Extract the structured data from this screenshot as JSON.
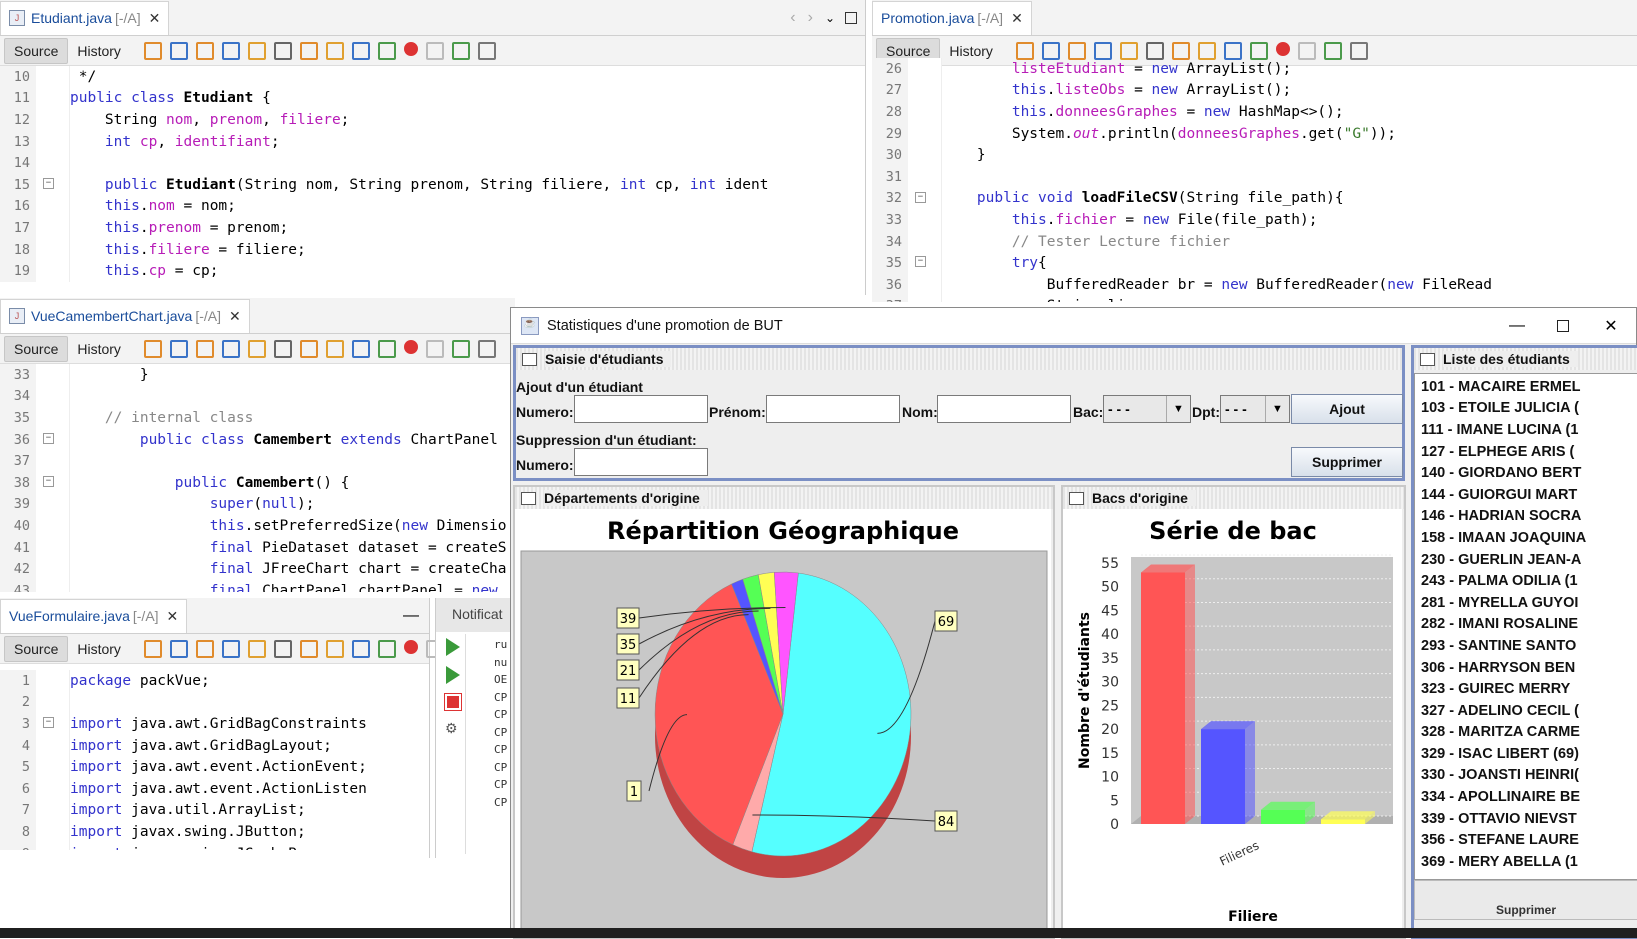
{
  "editor1": {
    "tab": {
      "file": "Etudiant.java",
      "mod": "[-/A]"
    },
    "source_label": "Source",
    "history_label": "History",
    "lines": [
      {
        "n": "10",
        "html": " */"
      },
      {
        "n": "11",
        "html": "<span class='kw'>public class</span> <b>Etudiant</b> {"
      },
      {
        "n": "12",
        "html": "    String <span class='fld'>nom</span>, <span class='fld'>prenom</span>, <span class='fld'>filiere</span>;"
      },
      {
        "n": "13",
        "html": "    <span class='kw'>int</span> <span class='fld'>cp</span>, <span class='fld'>identifiant</span>;"
      },
      {
        "n": "14",
        "html": ""
      },
      {
        "n": "15",
        "html": "    <span class='kw'>public</span> <b>Etudiant</b>(String nom, String prenom, String filiere, <span class='kw'>int</span> cp, <span class='kw'>int</span> ident"
      },
      {
        "n": "16",
        "html": "    <span class='kw'>this</span>.<span class='fld'>nom</span> = nom;"
      },
      {
        "n": "17",
        "html": "    <span class='kw'>this</span>.<span class='fld'>prenom</span> = prenom;"
      },
      {
        "n": "18",
        "html": "    <span class='kw'>this</span>.<span class='fld'>filiere</span> = filiere;"
      },
      {
        "n": "19",
        "html": "    <span class='kw'>this</span>.<span class='fld'>cp</span> = cp;"
      }
    ]
  },
  "editor2": {
    "tab": {
      "file": "Promotion.java",
      "mod": "[-/A]"
    },
    "source_label": "Source",
    "history_label": "History",
    "lines": [
      {
        "n": "26",
        "html": "        <span class='fld'>listeEtudiant</span> = <span class='kw'>new</span> ArrayList();"
      },
      {
        "n": "27",
        "html": "        <span class='kw'>this</span>.<span class='fld'>listeObs</span> = <span class='kw'>new</span> ArrayList();"
      },
      {
        "n": "28",
        "html": "        <span class='kw'>this</span>.<span class='fld'>donneesGraphes</span> = <span class='kw'>new</span> HashMap&lt;&gt;();"
      },
      {
        "n": "29",
        "html": "        System.<span class='fld'><i>out</i></span>.println(<span class='fld'>donneesGraphes</span>.get(<span class='str'>\"G\"</span>));"
      },
      {
        "n": "30",
        "html": "    }"
      },
      {
        "n": "31",
        "html": ""
      },
      {
        "n": "32",
        "html": "    <span class='kw'>public void</span> <b>loadFileCSV</b>(String file_path){"
      },
      {
        "n": "33",
        "html": "        <span class='kw'>this</span>.<span class='fld'>fichier</span> = <span class='kw'>new</span> File(file_path);"
      },
      {
        "n": "34",
        "html": "        <span class='cm'>// Tester Lecture fichier</span>"
      },
      {
        "n": "35",
        "html": "        <span class='kw'>try</span>{"
      },
      {
        "n": "36",
        "html": "            BufferedReader br = <span class='kw'>new</span> BufferedReader(<span class='kw'>new</span> FileRead"
      },
      {
        "n": "37",
        "html": "            String ligne;"
      }
    ]
  },
  "editor3": {
    "tab": {
      "file": "VueCamembertChart.java",
      "mod": "[-/A]"
    },
    "source_label": "Source",
    "history_label": "History",
    "lines": [
      {
        "n": "33",
        "html": "        }"
      },
      {
        "n": "34",
        "html": ""
      },
      {
        "n": "35",
        "html": "    <span class='cm'>// internal class</span>"
      },
      {
        "n": "36",
        "html": "        <span class='kw'>public class</span> <b>Camembert</b> <span class='kw'>extends</span> ChartPanel"
      },
      {
        "n": "37",
        "html": ""
      },
      {
        "n": "38",
        "html": "            <span class='kw'>public</span> <b>Camembert</b>() {"
      },
      {
        "n": "39",
        "html": "                <span class='kw'>super</span>(<span class='kw'>null</span>);"
      },
      {
        "n": "40",
        "html": "                <span class='kw'>this</span>.setPreferredSize(<span class='kw'>new</span> Dimensio"
      },
      {
        "n": "41",
        "html": "                <span class='kw'>final</span> PieDataset dataset = createS"
      },
      {
        "n": "42",
        "html": "                <span class='kw'>final</span> JFreeChart chart = createCha"
      },
      {
        "n": "43",
        "html": "                <span class='kw'>final</span> ChartPanel chartPanel = <span class='kw'>new</span>"
      }
    ]
  },
  "editor4": {
    "tab": {
      "file": "VueFormulaire.java",
      "mod": "[-/A]"
    },
    "source_label": "Source",
    "history_label": "History",
    "lines": [
      {
        "n": "1",
        "html": "<span class='kw'>package</span> packVue;"
      },
      {
        "n": "2",
        "html": ""
      },
      {
        "n": "3",
        "html": "<span class='kw'>import</span> java.awt.GridBagConstraints"
      },
      {
        "n": "4",
        "html": "<span class='kw'>import</span> java.awt.GridBagLayout;"
      },
      {
        "n": "5",
        "html": "<span class='kw'>import</span> java.awt.event.ActionEvent;"
      },
      {
        "n": "6",
        "html": "<span class='kw'>import</span> java.awt.event.ActionListen"
      },
      {
        "n": "7",
        "html": "<span class='kw'>import</span> java.util.ArrayList;"
      },
      {
        "n": "8",
        "html": "<span class='kw'>import</span> javax.swing.JButton;"
      },
      {
        "n": "9",
        "html": "<span class='kw'>import</span> javax.swing.JComboBox;"
      }
    ]
  },
  "notifications": {
    "title": "Notificat",
    "lines": [
      "ru",
      "nu",
      "OE",
      "CP",
      "CP",
      "CP",
      "CP",
      "CP",
      "CP",
      "CP"
    ]
  },
  "app": {
    "title": "Statistiques d'une promotion de BUT",
    "saisie": {
      "title": "Saisie d'étudiants",
      "ajout_label": "Ajout d'un étudiant",
      "numero_label": "Numero:",
      "prenom_label": "Prénom:",
      "nom_label": "Nom:",
      "bac_label": "Bac:",
      "bac_value": "- - -",
      "dpt_label": "Dpt:",
      "dpt_value": "- - -",
      "ajout_button": "Ajout",
      "suppression_label": "Suppression d'un étudiant:",
      "numero2_label": "Numero:",
      "supprimer_button": "Supprimer"
    },
    "liste": {
      "title": "Liste des étudiants",
      "items": [
        "101 - MACAIRE ERMEL",
        "103 - ETOILE JULICIA (",
        "111 - IMANE LUCINA (1",
        "127 - ELPHEGE ARIS (",
        "140 - GIORDANO BERT",
        "144 - GUIORGUI MART",
        "146 - HADRIAN SOCRA",
        "158 - IMAAN JOAQUINA",
        "230 - GUERLIN JEAN-A",
        "243 - PALMA ODILIA (1",
        "281 - MYRELLA GUYOI",
        "282 - IMANI ROSALINE",
        "293 - SANTINE SANTO",
        "306 - HARRYSON BEN",
        "323 - GUIREC MERRY",
        "327 - ADELINO CECIL (",
        "328 - MARITZA CARME",
        "329 - ISAC LIBERT (69)",
        "330 - JOANSTI HEINRI(",
        "334 - APOLLINAIRE BE",
        "339 - OTTAVIO NIEVST",
        "356 - STEFANE LAURE",
        "369 - MERY ABELLA (1"
      ],
      "footer": "Supprimer"
    },
    "departements": {
      "title": "Départements d'origine"
    },
    "bacs": {
      "title": "Bacs d'origine"
    }
  },
  "chart_data": [
    {
      "type": "pie",
      "title": "Répartition Géographique",
      "slices": [
        {
          "label": "69",
          "value": 52,
          "color": "#55ffff"
        },
        {
          "label": "84",
          "value": 2.5,
          "color": "#ffaaaa"
        },
        {
          "label": "1",
          "value": 37,
          "color": "#ff5555"
        },
        {
          "label": "11",
          "value": 1.5,
          "color": "#5555ff"
        },
        {
          "label": "21",
          "value": 2,
          "color": "#55ff55"
        },
        {
          "label": "35",
          "value": 2,
          "color": "#ffff55"
        },
        {
          "label": "39",
          "value": 3,
          "color": "#ff55ff"
        }
      ]
    },
    {
      "type": "bar",
      "title": "Série de bac",
      "xlabel": "Filiere",
      "ylabel": "Nombre d'étudiants",
      "categories": [
        "Filieres"
      ],
      "series": [
        {
          "values": [
            53
          ],
          "color": "#ff5555"
        },
        {
          "values": [
            20
          ],
          "color": "#5555ff"
        },
        {
          "values": [
            3
          ],
          "color": "#55ff55"
        },
        {
          "values": [
            1
          ],
          "color": "#ffff55"
        }
      ],
      "ylim": [
        0,
        55
      ],
      "yticks": [
        0,
        5,
        10,
        15,
        20,
        25,
        30,
        35,
        40,
        45,
        50,
        55
      ]
    }
  ]
}
